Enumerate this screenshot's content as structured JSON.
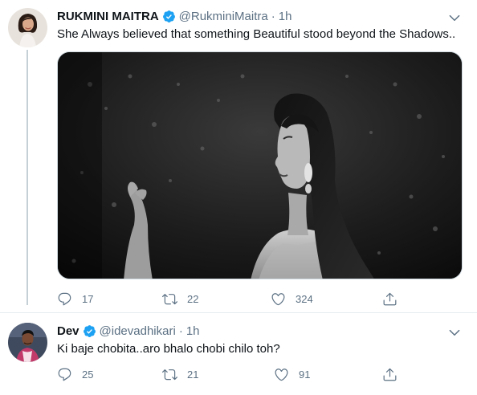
{
  "tweets": [
    {
      "name": "RUKMINI MAITRA",
      "handle": "@RukminiMaitra",
      "time": "1h",
      "text": "She Always believed that something Beautiful stood beyond the Shadows..",
      "replies": "17",
      "retweets": "22",
      "likes": "324"
    },
    {
      "name": "Dev",
      "handle": "@idevadhikari",
      "time": "1h",
      "text": "Ki baje chobita..aro bhalo chobi chilo toh?",
      "replies": "25",
      "retweets": "21",
      "likes": "91"
    }
  ],
  "separator": "·",
  "colors": {
    "verified": "#1da1f2",
    "muted": "#5b7083",
    "text": "#0f1419"
  }
}
